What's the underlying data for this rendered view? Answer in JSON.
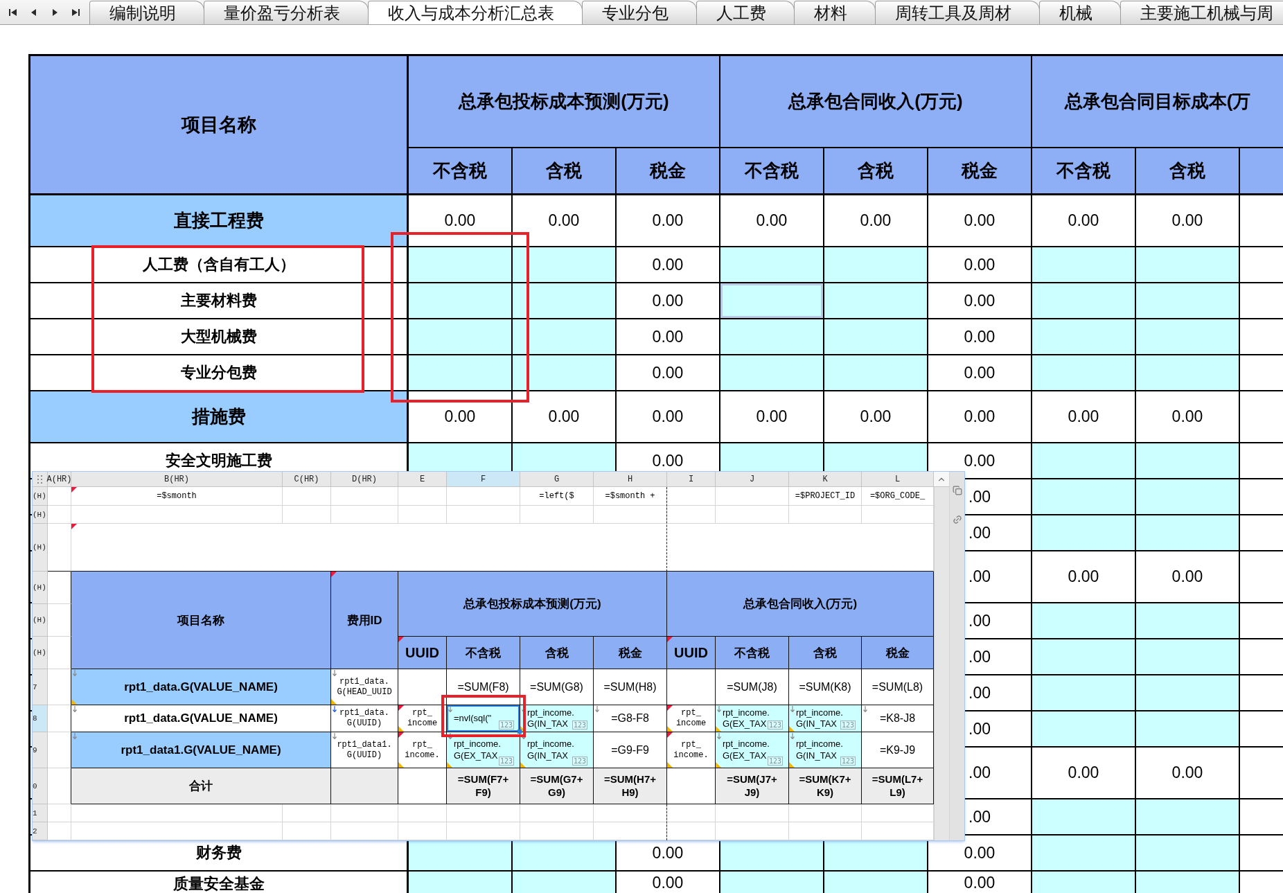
{
  "tabs": [
    {
      "label": "编制说明",
      "selected": false
    },
    {
      "label": "量价盈亏分析表",
      "selected": false
    },
    {
      "label": "收入与成本分析汇总表",
      "selected": true
    },
    {
      "label": "专业分包",
      "selected": false
    },
    {
      "label": "人工费",
      "selected": false
    },
    {
      "label": "材料",
      "selected": false
    },
    {
      "label": "周转工具及周材",
      "selected": false
    },
    {
      "label": "机械",
      "selected": false
    },
    {
      "label": "主要施工机械与周",
      "selected": false
    }
  ],
  "sheet": {
    "name_header": "项目名称",
    "groups": [
      {
        "title": "总承包投标成本预测(万元)",
        "columns": [
          "不含税",
          "含税",
          "税金"
        ]
      },
      {
        "title": "总承包合同收入(万元)",
        "columns": [
          "不含税",
          "含税",
          "税金"
        ]
      },
      {
        "title": "总承包合同目标成本(万",
        "columns": [
          "不含税",
          "含税"
        ]
      }
    ],
    "rows": [
      {
        "kind": "category",
        "name": "直接工程费",
        "cells": [
          {
            "kind": "value",
            "text": "0.00",
            "selected": false
          },
          {
            "kind": "value",
            "text": "0.00",
            "selected": false
          },
          {
            "kind": "value",
            "text": "0.00",
            "selected": false
          },
          {
            "kind": "value",
            "text": "0.00",
            "selected": false
          },
          {
            "kind": "value",
            "text": "0.00",
            "selected": false
          },
          {
            "kind": "value",
            "text": "0.00",
            "selected": false
          },
          {
            "kind": "value",
            "text": "0.00",
            "selected": false
          },
          {
            "kind": "value",
            "text": "0.00",
            "selected": false
          }
        ]
      },
      {
        "kind": "item",
        "name": "人工费（含自有工人）",
        "cells": [
          {
            "kind": "input",
            "selected": false
          },
          {
            "kind": "input",
            "selected": false
          },
          {
            "kind": "value",
            "text": "0.00",
            "selected": false
          },
          {
            "kind": "input",
            "selected": false
          },
          {
            "kind": "input",
            "selected": false
          },
          {
            "kind": "value",
            "text": "0.00",
            "selected": false
          },
          {
            "kind": "input",
            "selected": false
          },
          {
            "kind": "input",
            "selected": false
          }
        ]
      },
      {
        "kind": "item",
        "name": "主要材料费",
        "cells": [
          {
            "kind": "input",
            "selected": false
          },
          {
            "kind": "input",
            "selected": false
          },
          {
            "kind": "value",
            "text": "0.00",
            "selected": false
          },
          {
            "kind": "input",
            "selected": true
          },
          {
            "kind": "input",
            "selected": false
          },
          {
            "kind": "value",
            "text": "0.00",
            "selected": false
          },
          {
            "kind": "input",
            "selected": false
          },
          {
            "kind": "input",
            "selected": false
          }
        ]
      },
      {
        "kind": "item",
        "name": "大型机械费",
        "cells": [
          {
            "kind": "input",
            "selected": false
          },
          {
            "kind": "input",
            "selected": false
          },
          {
            "kind": "value",
            "text": "0.00",
            "selected": false
          },
          {
            "kind": "input",
            "selected": false
          },
          {
            "kind": "input",
            "selected": false
          },
          {
            "kind": "value",
            "text": "0.00",
            "selected": false
          },
          {
            "kind": "input",
            "selected": false
          },
          {
            "kind": "input",
            "selected": false
          }
        ]
      },
      {
        "kind": "item",
        "name": "专业分包费",
        "cells": [
          {
            "kind": "input",
            "selected": false
          },
          {
            "kind": "input",
            "selected": false
          },
          {
            "kind": "value",
            "text": "0.00",
            "selected": false
          },
          {
            "kind": "input",
            "selected": false
          },
          {
            "kind": "input",
            "selected": false
          },
          {
            "kind": "value",
            "text": "0.00",
            "selected": false
          },
          {
            "kind": "input",
            "selected": false
          },
          {
            "kind": "input",
            "selected": false
          }
        ]
      },
      {
        "kind": "category",
        "name": "措施费",
        "cells": [
          {
            "kind": "value",
            "text": "0.00",
            "selected": false
          },
          {
            "kind": "value",
            "text": "0.00",
            "selected": false
          },
          {
            "kind": "value",
            "text": "0.00",
            "selected": false
          },
          {
            "kind": "value",
            "text": "0.00",
            "selected": false
          },
          {
            "kind": "value",
            "text": "0.00",
            "selected": false
          },
          {
            "kind": "value",
            "text": "0.00",
            "selected": false
          },
          {
            "kind": "value",
            "text": "0.00",
            "selected": false
          },
          {
            "kind": "value",
            "text": "0.00",
            "selected": false
          }
        ]
      },
      {
        "kind": "item",
        "name": "安全文明施工费",
        "cells": [
          {
            "kind": "input",
            "selected": false
          },
          {
            "kind": "input",
            "selected": false
          },
          {
            "kind": "value",
            "text": "0.00",
            "selected": false
          },
          {
            "kind": "input",
            "selected": false
          },
          {
            "kind": "input",
            "selected": false
          },
          {
            "kind": "value",
            "text": "0.00",
            "selected": false
          },
          {
            "kind": "input",
            "selected": false
          },
          {
            "kind": "input",
            "selected": false
          }
        ]
      },
      {
        "kind": "item",
        "cells": [
          {
            "kind": "value",
            "text": ".00",
            "selected": false
          },
          {
            "kind": "input",
            "selected": false
          },
          {
            "kind": "input",
            "selected": false
          }
        ]
      },
      {
        "kind": "item",
        "cells": [
          {
            "kind": "value",
            "text": ".00",
            "selected": false
          },
          {
            "kind": "input",
            "selected": false
          },
          {
            "kind": "input",
            "selected": false
          }
        ]
      },
      {
        "kind": "category",
        "cells": [
          {
            "kind": "value",
            "text": ".00",
            "selected": false
          },
          {
            "kind": "value",
            "text": "0.00",
            "selected": false
          },
          {
            "kind": "value",
            "text": "0.00",
            "selected": false
          }
        ]
      },
      {
        "kind": "item",
        "cells": [
          {
            "kind": "value",
            "text": ".00",
            "selected": false
          },
          {
            "kind": "input",
            "selected": false
          },
          {
            "kind": "input",
            "selected": false
          }
        ]
      },
      {
        "kind": "item",
        "cells": [
          {
            "kind": "value",
            "text": ".00",
            "selected": false
          },
          {
            "kind": "input",
            "selected": false
          },
          {
            "kind": "input",
            "selected": false
          }
        ]
      },
      {
        "kind": "item",
        "cells": [
          {
            "kind": "value",
            "text": ".00",
            "selected": false
          },
          {
            "kind": "input",
            "selected": false
          },
          {
            "kind": "input",
            "selected": false
          }
        ]
      },
      {
        "kind": "item",
        "cells": [
          {
            "kind": "value",
            "text": ".00",
            "selected": false
          },
          {
            "kind": "input",
            "selected": false
          },
          {
            "kind": "input",
            "selected": false
          }
        ]
      },
      {
        "kind": "category",
        "cells": [
          {
            "kind": "value",
            "text": ".00",
            "selected": false
          },
          {
            "kind": "value",
            "text": "0.00",
            "selected": false
          },
          {
            "kind": "value",
            "text": "0.00",
            "selected": false
          }
        ]
      },
      {
        "kind": "item",
        "cells": [
          {
            "kind": "value",
            "text": ".00",
            "selected": false
          },
          {
            "kind": "input",
            "selected": false
          },
          {
            "kind": "input",
            "selected": false
          }
        ]
      },
      {
        "kind": "item",
        "name": "财务费",
        "cells": [
          {
            "kind": "input",
            "selected": false
          },
          {
            "kind": "input",
            "selected": false
          },
          {
            "kind": "value",
            "text": "0.00",
            "selected": false
          },
          {
            "kind": "input",
            "selected": false
          },
          {
            "kind": "input",
            "selected": false
          },
          {
            "kind": "value",
            "text": "0.00",
            "selected": false
          },
          {
            "kind": "input",
            "selected": false
          },
          {
            "kind": "input",
            "selected": false
          }
        ]
      },
      {
        "kind": "item",
        "name": "质量安全基金",
        "cells": [
          {
            "kind": "input",
            "selected": false
          },
          {
            "kind": "input",
            "selected": false
          },
          {
            "kind": "value",
            "text": "0.00",
            "selected": false
          },
          {
            "kind": "input",
            "selected": false
          },
          {
            "kind": "input",
            "selected": false
          },
          {
            "kind": "value",
            "text": "0.00",
            "selected": false
          },
          {
            "kind": "input",
            "selected": false
          },
          {
            "kind": "input",
            "selected": false
          }
        ]
      }
    ]
  },
  "designer": {
    "columns": [
      {
        "label": "A(HR)",
        "selected": false
      },
      {
        "label": "B(HR)",
        "selected": false
      },
      {
        "label": "C(HR)",
        "selected": false
      },
      {
        "label": "D(HR)",
        "selected": false
      },
      {
        "label": "E",
        "selected": false
      },
      {
        "label": "F",
        "selected": true
      },
      {
        "label": "G",
        "selected": false
      },
      {
        "label": "H",
        "selected": false
      },
      {
        "label": "I",
        "selected": false
      },
      {
        "label": "J",
        "selected": false
      },
      {
        "label": "K",
        "selected": false
      },
      {
        "label": "L",
        "selected": false
      }
    ],
    "header": {
      "name": "项目名称",
      "id": {
        "text": "费用ID",
        "marks": [
          {
            "kind": "note"
          }
        ]
      },
      "groups": [
        {
          "title": "总承包投标成本预测(万元)",
          "columns": [
            {
              "text": "UUID",
              "marks": [
                {
                  "kind": "note"
                }
              ]
            },
            {
              "text": "不含税"
            },
            {
              "text": "含税"
            },
            {
              "text": "税金"
            }
          ]
        },
        {
          "title": "总承包合同收入(万元)",
          "columns": [
            {
              "text": "UUID",
              "marks": [
                {
                  "kind": "note"
                }
              ]
            },
            {
              "text": "不含税"
            },
            {
              "text": "含税"
            },
            {
              "text": "税金"
            }
          ]
        }
      ]
    },
    "rows": [
      {
        "label": "(H)",
        "selected": false,
        "kind": "params",
        "cells": [
          {
            "kind": "blank"
          },
          {
            "kind": "code",
            "text": "=$smonth",
            "marks": [
              {
                "kind": "note"
              }
            ]
          },
          {
            "kind": "blank"
          },
          {
            "kind": "blank"
          },
          {
            "kind": "blank"
          },
          {
            "kind": "blank"
          },
          {
            "kind": "code",
            "text": "=left($"
          },
          {
            "kind": "code",
            "text": "=$smonth +"
          },
          {
            "kind": "blank"
          },
          {
            "kind": "blank"
          },
          {
            "kind": "code",
            "text": "=$PROJECT_ID"
          },
          {
            "kind": "code",
            "text": "=$ORG_CODE_"
          }
        ]
      },
      {
        "label": "(H)",
        "selected": false,
        "kind": "blank"
      },
      {
        "label": "(H)",
        "selected": false,
        "kind": "title",
        "marks": [
          {
            "kind": "note"
          }
        ]
      },
      {
        "label": "(H)",
        "selected": false,
        "kind": "head"
      },
      {
        "label": "(H)",
        "selected": false,
        "kind": "head"
      },
      {
        "label": "(H)",
        "selected": false,
        "kind": "head"
      },
      {
        "label": "7",
        "selected": false,
        "kind": "group",
        "name": {
          "text": "rpt1_data.G(VALUE_NAME)",
          "marks": [
            {
              "kind": "down",
              "current": false
            },
            {
              "kind": "extend"
            }
          ]
        },
        "cells": [
          {
            "kind": "code",
            "text": "rpt1_data.\nG(HEAD_UUID",
            "marks": [
              {
                "kind": "down",
                "current": false
              },
              {
                "kind": "extend"
              }
            ],
            "selected": false
          },
          {
            "kind": "blank",
            "selected": false
          },
          {
            "kind": "formula",
            "text": "=SUM(F8)",
            "selected": false
          },
          {
            "kind": "formula",
            "text": "=SUM(G8)",
            "selected": false
          },
          {
            "kind": "formula",
            "text": "=SUM(H8)",
            "selected": false
          },
          {
            "kind": "blank",
            "selected": false
          },
          {
            "kind": "formula",
            "text": "=SUM(J8)",
            "selected": false
          },
          {
            "kind": "formula",
            "text": "=SUM(K8)",
            "selected": false
          },
          {
            "kind": "formula",
            "text": "=SUM(L8)",
            "selected": false
          }
        ]
      },
      {
        "label": "8",
        "selected": true,
        "kind": "detail",
        "name": {
          "text": "rpt1_data.G(VALUE_NAME)",
          "marks": [
            {
              "kind": "down",
              "current": false
            }
          ]
        },
        "cells": [
          {
            "kind": "code",
            "text": "rpt1_data.\nG(UUID)",
            "marks": [
              {
                "kind": "down",
                "current": true
              }
            ],
            "selected": false
          },
          {
            "kind": "code",
            "text": "rpt_\nincome",
            "marks": [
              {
                "kind": "note"
              },
              {
                "kind": "extend"
              }
            ],
            "selected": false
          },
          {
            "kind": "field",
            "text": "=nvl(sql(\"",
            "marks": [
              {
                "kind": "down",
                "current": false
              }
            ],
            "badge": "123",
            "selected": true
          },
          {
            "kind": "field",
            "text": "rpt_income.\nG(IN_TAX",
            "marks": [
              {
                "kind": "down",
                "current": false
              },
              {
                "kind": "extend"
              }
            ],
            "badge": "123",
            "selected": false
          },
          {
            "kind": "formula",
            "text": "=G8-F8",
            "marks": [
              {
                "kind": "down",
                "current": false
              }
            ],
            "selected": false
          },
          {
            "kind": "code",
            "text": "rpt_\nincome",
            "marks": [
              {
                "kind": "note"
              },
              {
                "kind": "extend"
              }
            ],
            "selected": false
          },
          {
            "kind": "field",
            "text": "rpt_income.\nG(EX_TAX",
            "marks": [
              {
                "kind": "down",
                "current": false
              },
              {
                "kind": "extend"
              }
            ],
            "badge": "123",
            "selected": false
          },
          {
            "kind": "field",
            "text": "rpt_income.\nG(IN_TAX",
            "marks": [
              {
                "kind": "down",
                "current": false
              },
              {
                "kind": "extend"
              }
            ],
            "badge": "123",
            "selected": false
          },
          {
            "kind": "formula",
            "text": "=K8-J8",
            "marks": [
              {
                "kind": "down",
                "current": false
              }
            ],
            "selected": false
          }
        ]
      },
      {
        "label": "9",
        "selected": false,
        "kind": "group",
        "name": {
          "text": "rpt1_data1.G(VALUE_NAME)",
          "marks": [
            {
              "kind": "down",
              "current": false
            }
          ]
        },
        "cells": [
          {
            "kind": "code",
            "text": "rpt1_data1.\nG(UUID)",
            "marks": [
              {
                "kind": "down",
                "current": false
              }
            ],
            "selected": false
          },
          {
            "kind": "code",
            "text": "rpt_\nincome.",
            "marks": [
              {
                "kind": "note"
              },
              {
                "kind": "extend"
              }
            ],
            "selected": false
          },
          {
            "kind": "field",
            "text": "rpt_income.\nG(EX_TAX",
            "marks": [
              {
                "kind": "down",
                "current": false
              },
              {
                "kind": "extend"
              }
            ],
            "badge": "123",
            "selected": false
          },
          {
            "kind": "field",
            "text": "rpt_income.\nG(IN_TAX",
            "marks": [
              {
                "kind": "down",
                "current": false
              },
              {
                "kind": "extend"
              }
            ],
            "badge": "123",
            "selected": false
          },
          {
            "kind": "formula",
            "text": "=G9-F9",
            "selected": false
          },
          {
            "kind": "code",
            "text": "rpt_\nincome.",
            "marks": [
              {
                "kind": "note"
              },
              {
                "kind": "extend"
              }
            ],
            "selected": false
          },
          {
            "kind": "field",
            "text": "rpt_income.\nG(EX_TAX",
            "marks": [
              {
                "kind": "down",
                "current": false
              },
              {
                "kind": "extend"
              }
            ],
            "badge": "123",
            "selected": false
          },
          {
            "kind": "field",
            "text": "rpt_income.\nG(IN_TAX",
            "marks": [
              {
                "kind": "down",
                "current": false
              },
              {
                "kind": "extend"
              }
            ],
            "badge": "123",
            "selected": false
          },
          {
            "kind": "formula",
            "text": "=K9-J9",
            "selected": false
          }
        ]
      },
      {
        "label": "0",
        "selected": false,
        "kind": "total",
        "name": {
          "text": "合计"
        },
        "cells": [
          {
            "kind": "shaded",
            "selected": false
          },
          {
            "kind": "blank",
            "selected": false
          },
          {
            "kind": "total",
            "text": "=SUM(F7+\nF9)",
            "selected": false
          },
          {
            "kind": "total",
            "text": "=SUM(G7+\nG9)",
            "selected": false
          },
          {
            "kind": "total",
            "text": "=SUM(H7+\nH9)",
            "selected": false
          },
          {
            "kind": "blank",
            "selected": false
          },
          {
            "kind": "total",
            "text": "=SUM(J7+\nJ9)",
            "selected": false
          },
          {
            "kind": "total",
            "text": "=SUM(K7+\nK9)",
            "selected": false
          },
          {
            "kind": "total",
            "text": "=SUM(L7+\nL9)",
            "selected": false
          }
        ]
      },
      {
        "label": "1",
        "selected": false,
        "kind": "blank"
      },
      {
        "label": "2",
        "selected": false,
        "kind": "blank"
      }
    ]
  }
}
